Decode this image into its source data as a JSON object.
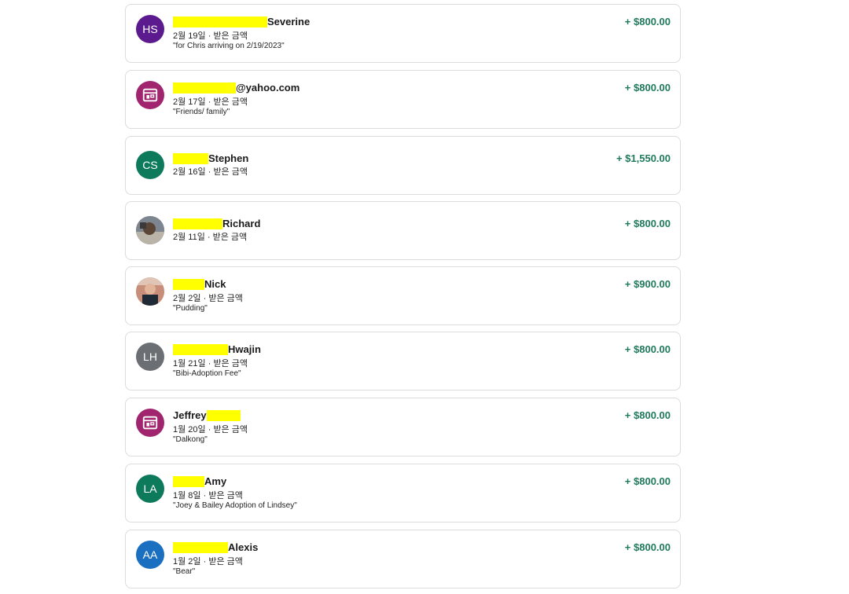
{
  "transactions": [
    {
      "initials": "HS",
      "avatar_color": "#5b1a8e",
      "avatar_kind": "initials",
      "name_suffix": "Severine",
      "name_prefix": "",
      "date": "2월 19일",
      "type": "받은 금액",
      "note": "\"for Chris arriving on 2/19/2023\"",
      "amount": "+ $800.00"
    },
    {
      "initials": "",
      "avatar_color": "#a0256e",
      "avatar_kind": "store-icon",
      "name_suffix": "@yahoo.com",
      "name_prefix": "",
      "date": "2월 17일",
      "type": "받은 금액",
      "note": "\"Friends/ family\"",
      "amount": "+ $800.00"
    },
    {
      "initials": "CS",
      "avatar_color": "#0e7a5c",
      "avatar_kind": "initials",
      "name_suffix": "Stephen",
      "name_prefix": "",
      "date": "2월 16일",
      "type": "받은 금액",
      "note": "",
      "amount": "+ $1,550.00"
    },
    {
      "initials": "",
      "avatar_color": "#8a7a6a",
      "avatar_kind": "photo",
      "name_suffix": "Richard",
      "name_prefix": "",
      "date": "2월 11일",
      "type": "받은 금액",
      "note": "",
      "amount": "+ $800.00"
    },
    {
      "initials": "",
      "avatar_color": "#c9a48a",
      "avatar_kind": "photo",
      "name_suffix": "Nick",
      "name_prefix": "",
      "date": "2월 2일",
      "type": "받은 금액",
      "note": "\"Pudding\"",
      "amount": "+ $900.00"
    },
    {
      "initials": "LH",
      "avatar_color": "#6b6e72",
      "avatar_kind": "initials",
      "name_suffix": "Hwajin",
      "name_prefix": "",
      "date": "1월 21일",
      "type": "받은 금액",
      "note": "\"Bibi-Adoption Fee\"",
      "amount": "+ $800.00"
    },
    {
      "initials": "",
      "avatar_color": "#a0256e",
      "avatar_kind": "store-icon",
      "name_suffix": "",
      "name_prefix": "Jeffrey",
      "date": "1월 20일",
      "type": "받은 금액",
      "note": "\"Dalkong\"",
      "amount": "+ $800.00"
    },
    {
      "initials": "LA",
      "avatar_color": "#0e7a5c",
      "avatar_kind": "initials",
      "name_suffix": "Amy",
      "name_prefix": "",
      "date": "1월 8일",
      "type": "받은 금액",
      "note": "\"Joey & Bailey Adoption of Lindsey\"",
      "amount": "+ $800.00"
    },
    {
      "initials": "AA",
      "avatar_color": "#1a6fc0",
      "avatar_kind": "initials",
      "name_suffix": "Alexis",
      "name_prefix": "",
      "date": "1월 2일",
      "type": "받은 금액",
      "note": "\"Bear\"",
      "amount": "+ $800.00"
    }
  ]
}
